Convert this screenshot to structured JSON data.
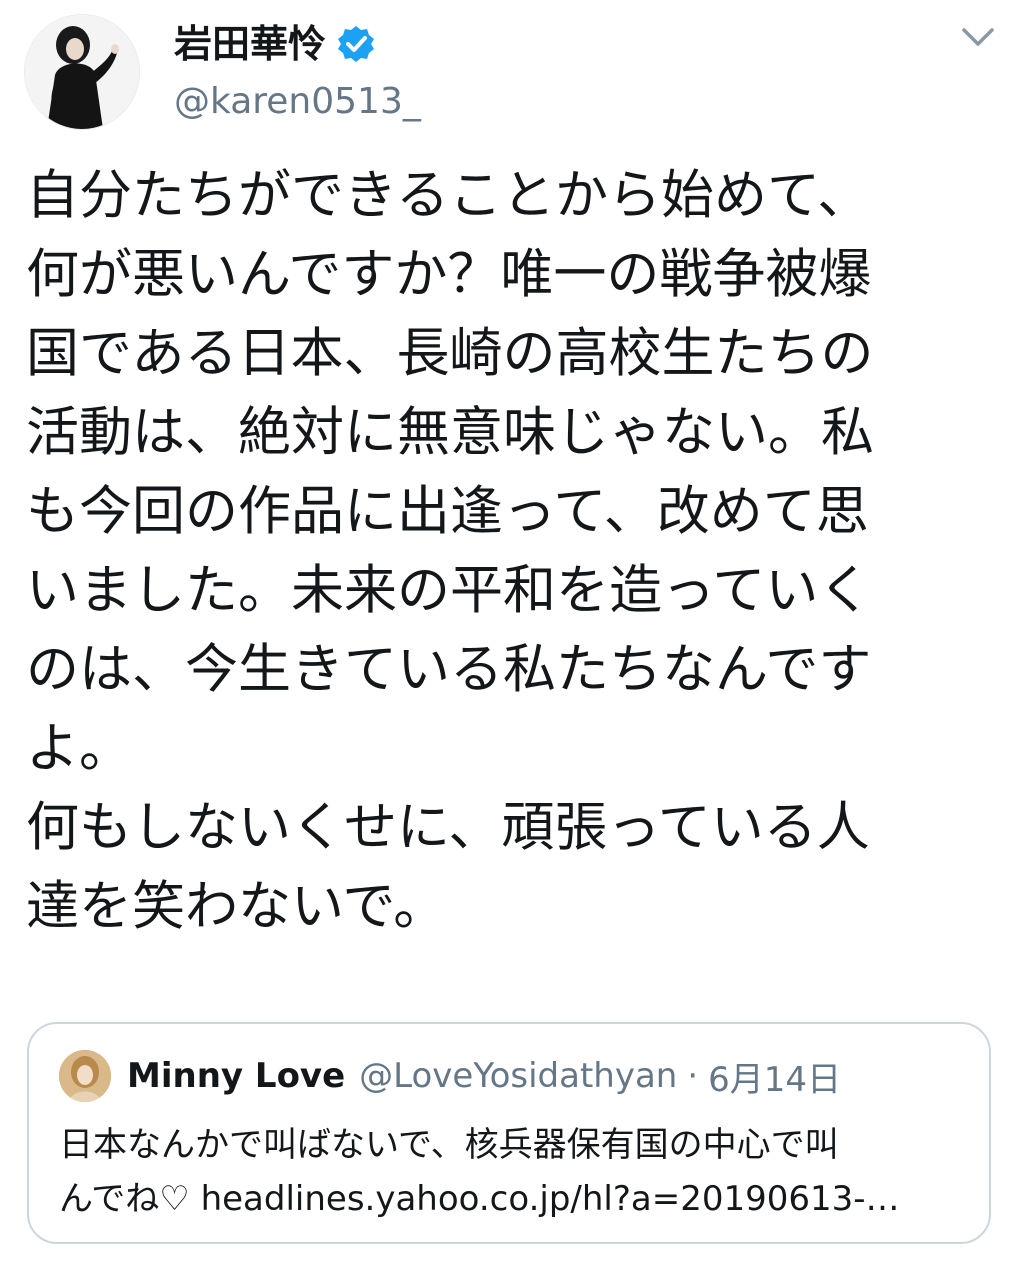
{
  "author": {
    "display_name": "岩田華怜",
    "handle": "@karen0513_",
    "verified": true,
    "avatar_icon": "profile-photo"
  },
  "tweet": {
    "lines": [
      "自分たちができることから始めて、",
      "何が悪いんですか？唯一の戦争被爆",
      "国である日本、長崎の高校生たちの",
      "活動は、絶対に無意味じゃない。私",
      "も今回の作品に出逢って、改めて思",
      "いました。未来の平和を造っていく",
      "のは、今生きている私たちなんです",
      "よ。",
      "何もしないくせに、頑張っている人",
      "達を笑わないで。"
    ]
  },
  "quoted_tweet": {
    "display_name": "Minny Love",
    "handle": "@LoveYosidathyan",
    "separator": "·",
    "date": "6月14日",
    "lines": [
      "日本なんかで叫ばないで、核兵器保有国の中心で叫",
      "んでね♡ headlines.yahoo.co.jp/hl?a=20190613-…"
    ]
  },
  "colors": {
    "text": "#14171a",
    "secondary": "#657786",
    "verified": "#1da1f2",
    "border": "#ccd6dd"
  },
  "icons": {
    "verified": "verified-badge-icon",
    "menu": "chevron-down-icon"
  }
}
